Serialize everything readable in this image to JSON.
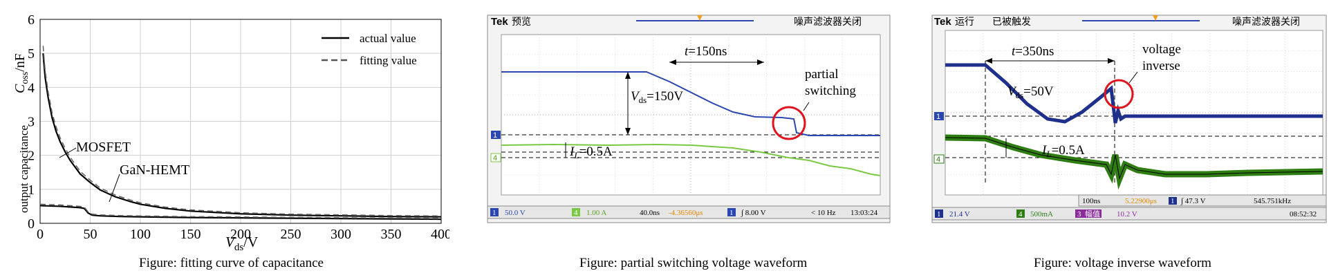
{
  "panels": {
    "left": {
      "caption": "Figure: fitting curve of capacitance"
    },
    "middle": {
      "caption": "Figure: partial switching voltage waveform"
    },
    "right": {
      "caption": "Figure: voltage inverse waveform"
    }
  },
  "chart_data": [
    {
      "type": "line",
      "xlabel_main": "V",
      "xlabel_sub": "ds",
      "xlabel_unit": "/V",
      "ylabel_upper_main": "C",
      "ylabel_upper_sub": "oss",
      "ylabel_upper_unit": "/nF",
      "ylabel_lower": "output capacitance",
      "xlim": [
        0,
        400
      ],
      "ylim": [
        0,
        6
      ],
      "x_ticks": [
        "0",
        "50",
        "100",
        "150",
        "200",
        "250",
        "300",
        "350",
        "400"
      ],
      "y_ticks": [
        "0",
        "1",
        "2",
        "3",
        "4",
        "5",
        "6"
      ],
      "grid": true,
      "legend_position": "top-right",
      "legend": [
        {
          "label": "actual value",
          "style": "solid"
        },
        {
          "label": "fitting value",
          "style": "dashed"
        }
      ],
      "annotations": [
        "MOSFET",
        "GaN-HEMT"
      ],
      "series": [
        {
          "name": "MOSFET",
          "x": [
            3,
            5,
            8,
            12,
            16,
            20,
            25,
            30,
            40,
            50,
            60,
            75,
            90,
            100,
            125,
            150,
            200,
            250,
            300,
            350,
            400
          ],
          "y": [
            5.0,
            4.3,
            3.7,
            3.1,
            2.7,
            2.4,
            2.1,
            1.85,
            1.45,
            1.2,
            0.98,
            0.78,
            0.64,
            0.56,
            0.44,
            0.36,
            0.28,
            0.24,
            0.22,
            0.2,
            0.19
          ]
        },
        {
          "name": "GaN-HEMT",
          "x": [
            0,
            10,
            20,
            30,
            40,
            44,
            48,
            52,
            60,
            80,
            100,
            150,
            200,
            250,
            300,
            350,
            400
          ],
          "y": [
            0.52,
            0.51,
            0.5,
            0.48,
            0.46,
            0.44,
            0.3,
            0.24,
            0.22,
            0.2,
            0.19,
            0.17,
            0.16,
            0.15,
            0.14,
            0.13,
            0.12
          ]
        }
      ]
    },
    {
      "type": "line",
      "scope_header": [
        "Tek",
        "预览",
        "噪声滤波器关闭"
      ],
      "annotations": {
        "t": "t",
        "t_value": "=150ns",
        "vds_main": "V",
        "vds_sub": "ds",
        "vds_value": "=150V",
        "il_main": "I",
        "il_sub": "L",
        "il_value": "=0.5A",
        "partial_line1": "partial",
        "partial_line2": "switching"
      },
      "channel_markers": [
        "1",
        "4"
      ],
      "status_bar": [
        "1",
        "50.0 V",
        "4",
        "1.00 A",
        "40.0ns",
        "-4.36560μs",
        "1",
        "∫ 8.00 V",
        "< 10 Hz",
        "13:03:24"
      ],
      "colors": {
        "channel1": "#2b46b0",
        "channel4": "#7ac943",
        "circle": "#e0141e"
      }
    },
    {
      "type": "line",
      "scope_header": [
        "Tek",
        "运行",
        "已被触发",
        "噪声滤波器关闭"
      ],
      "annotations": {
        "t": "t",
        "t_value": "=350ns",
        "vds_main": "V",
        "vds_sub": "ds",
        "vds_value": "=50V",
        "il_main": "I",
        "il_sub": "L",
        "il_value": "=0.5A",
        "inv_line1": "voltage",
        "inv_line2": "inverse"
      },
      "channel_markers": [
        "1",
        "4"
      ],
      "status_bar_top": [
        "100ns",
        "5.22900μs",
        "1",
        "∫ 47.3 V",
        "545.751kHz"
      ],
      "status_bar": [
        "1",
        "21.4 V",
        "4",
        "500mA",
        "3",
        "幅值",
        "10.2 V",
        "08:52:32"
      ],
      "colors": {
        "channel1": "#1f2f8c",
        "channel4": "#2e7d12",
        "circle": "#e0141e"
      }
    }
  ]
}
